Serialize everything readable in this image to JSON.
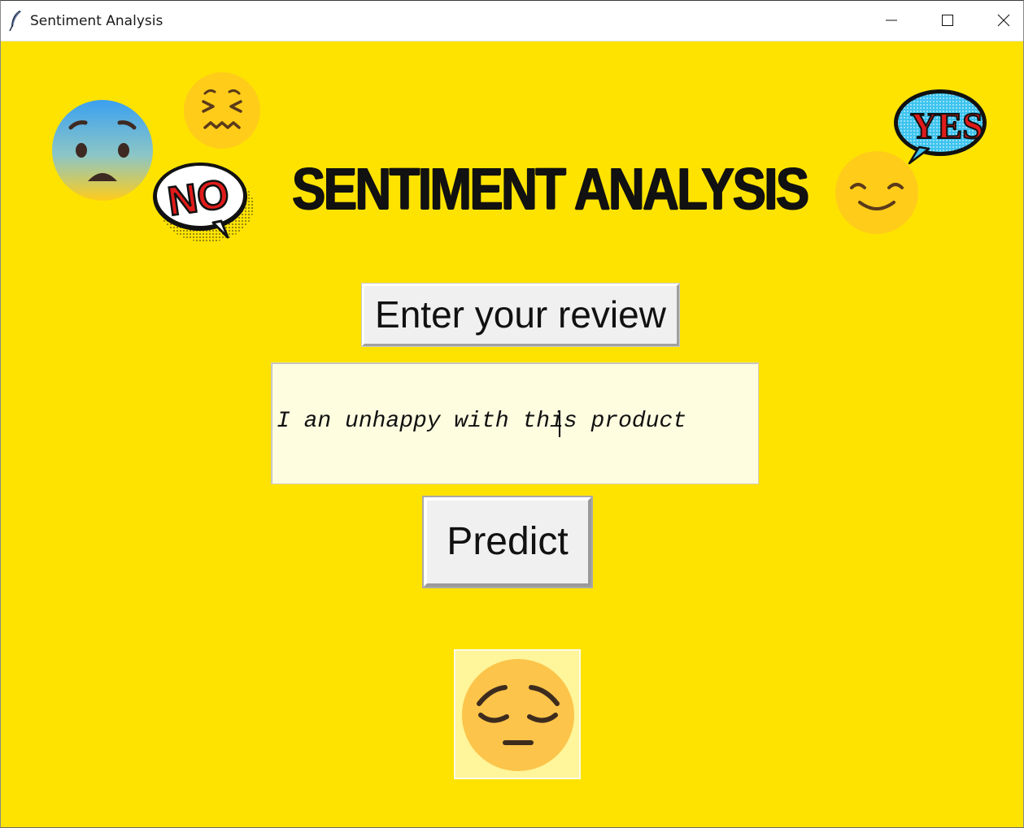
{
  "window": {
    "title": "Sentiment Analysis"
  },
  "header": {
    "title": "SENTIMENT ANALYSIS"
  },
  "stickers": {
    "no_text": "NO",
    "yes_text": "YES"
  },
  "review": {
    "label": "Enter your review",
    "value": "I an unhappy with this product"
  },
  "predict": {
    "label": "Predict"
  },
  "result": {
    "icon": "pensive-face-icon"
  },
  "colors": {
    "background": "#ffe300",
    "entry_background": "#fffde0",
    "button_face": "#f0f0f0",
    "result_background": "#fff59a"
  }
}
